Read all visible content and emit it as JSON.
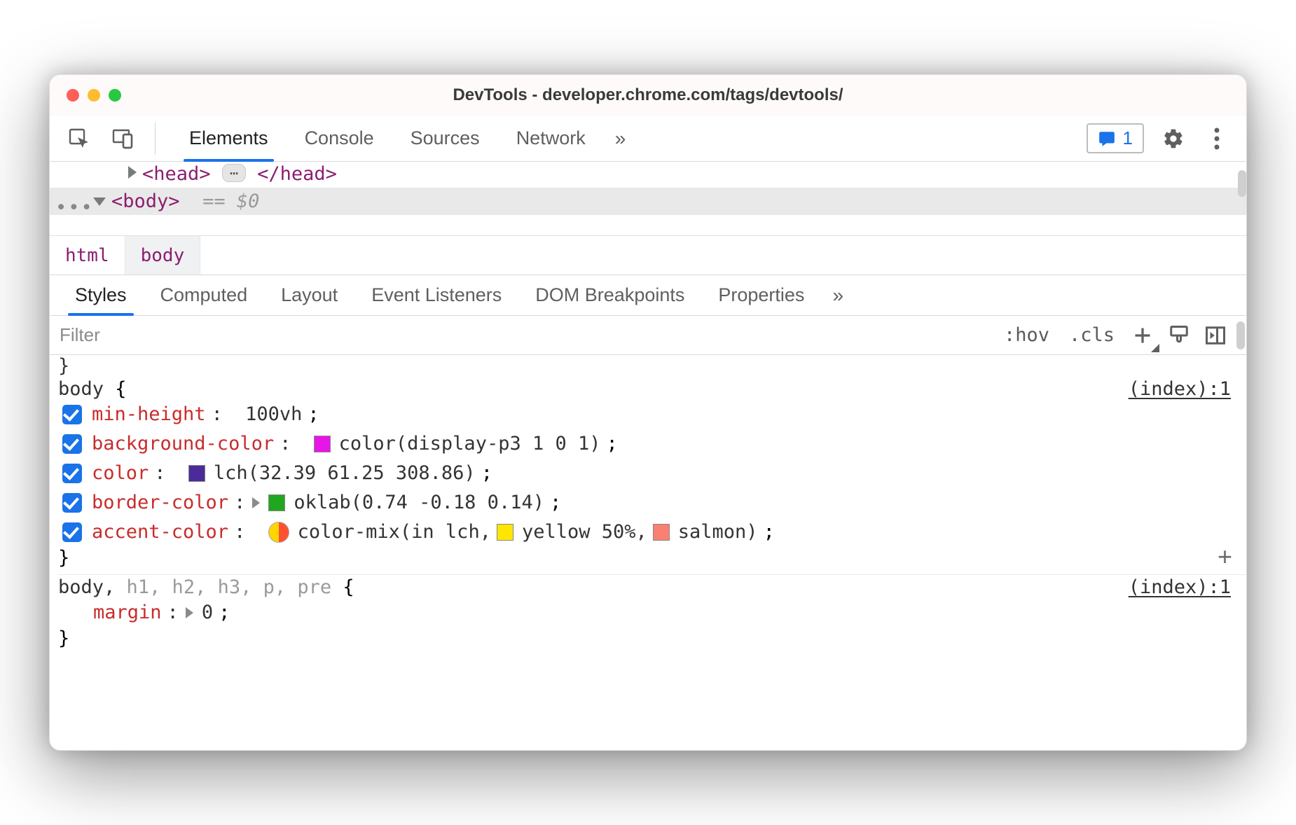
{
  "window": {
    "title": "DevTools - developer.chrome.com/tags/devtools/"
  },
  "toolbar": {
    "tabs": [
      "Elements",
      "Console",
      "Sources",
      "Network"
    ],
    "active_tab_index": 0,
    "more_glyph": "»",
    "issues_count": "1"
  },
  "dom": {
    "head_open": "<head>",
    "head_close": "</head>",
    "body_open": "<body>",
    "eq": "== ",
    "dollar0": "$0"
  },
  "breadcrumb": {
    "items": [
      "html",
      "body"
    ],
    "selected_index": 1
  },
  "subpanels": {
    "tabs": [
      "Styles",
      "Computed",
      "Layout",
      "Event Listeners",
      "DOM Breakpoints",
      "Properties"
    ],
    "active_index": 0,
    "more_glyph": "»"
  },
  "filter": {
    "placeholder": "Filter",
    "hov": ":hov",
    "cls": ".cls"
  },
  "rules": [
    {
      "selector": "body",
      "selector_dim": "",
      "source": "(index):1",
      "decls": [
        {
          "prop": "min-height",
          "value": "100vh",
          "expand": false,
          "swatches": []
        },
        {
          "prop": "background-color",
          "value": "color(display-p3 1 0 1)",
          "expand": false,
          "swatches": [
            {
              "color": "#e815e8"
            }
          ]
        },
        {
          "prop": "color",
          "value": "lch(32.39 61.25 308.86)",
          "expand": false,
          "swatches": [
            {
              "color": "#4a2b99"
            }
          ]
        },
        {
          "prop": "border-color",
          "value": "oklab(0.74 -0.18 0.14)",
          "expand": true,
          "swatches": [
            {
              "color": "#1fa71f"
            }
          ]
        },
        {
          "prop": "accent-color",
          "value_parts": {
            "prefix": "color-mix(in lch, ",
            "mid1_swatch": "#ffe600",
            "mid1_text": "yellow 50%, ",
            "mid2_swatch": "#fa8072",
            "mid2_text": "salmon)"
          },
          "expand": false,
          "mix": true
        }
      ],
      "show_add": true
    },
    {
      "selector": "body,",
      "selector_dim": " h1, h2, h3, p, pre",
      "source": "(index):1",
      "decls": [
        {
          "prop": "margin",
          "value": "0",
          "expand": true,
          "swatches": [],
          "nocheck": true
        }
      ],
      "show_add": false
    }
  ]
}
